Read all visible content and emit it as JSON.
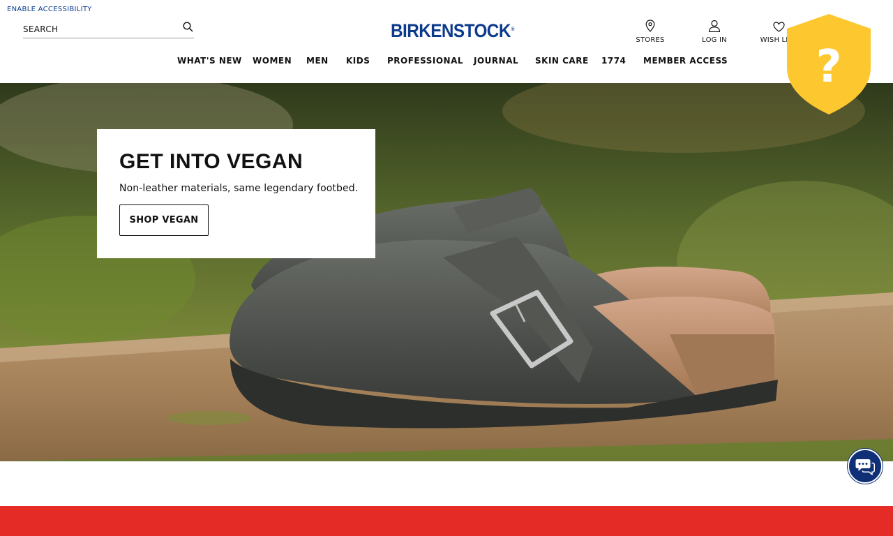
{
  "accessibility": {
    "label": "ENABLE ACCESSIBILITY"
  },
  "search": {
    "placeholder": "SEARCH"
  },
  "brand": {
    "name": "BIRKENSTOCK",
    "mark": "®",
    "color": "#0d3b8c"
  },
  "utility": {
    "stores": {
      "label": "STORES",
      "icon": "location-pin-icon"
    },
    "login": {
      "label": "LOG IN",
      "icon": "user-icon"
    },
    "wishlist": {
      "label": "WISH LIST",
      "icon": "heart-icon"
    }
  },
  "nav": {
    "items": [
      {
        "label": "WHAT'S NEW"
      },
      {
        "label": "WOMEN"
      },
      {
        "label": "MEN"
      },
      {
        "label": "KIDS"
      },
      {
        "label": "PROFESSIONAL"
      },
      {
        "label": "JOURNAL"
      },
      {
        "label": "SKIN CARE"
      },
      {
        "label": "1774"
      },
      {
        "label": "MEMBER ACCESS"
      }
    ]
  },
  "hero": {
    "title": "GET INTO VEGAN",
    "subtitle": "Non-leather materials, same legendary footbed.",
    "cta": "SHOP VEGAN"
  },
  "help_badge": {
    "icon": "question-shield-icon",
    "color": "#fcc72f"
  },
  "chat": {
    "icon": "chat-bubbles-icon",
    "color": "#0f2f76"
  },
  "colors": {
    "accent_red": "#e52b26"
  }
}
